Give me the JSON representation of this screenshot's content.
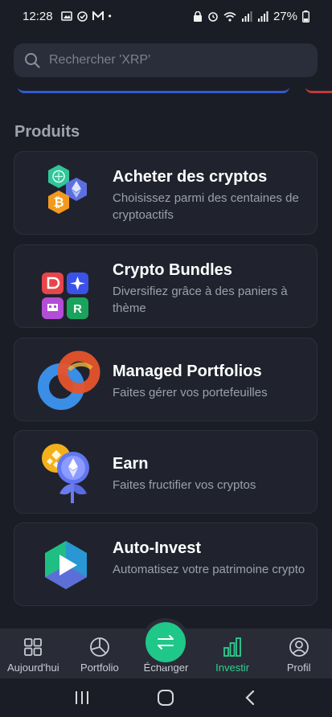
{
  "status_bar": {
    "time": "12:28",
    "battery": "27%",
    "dot": "•"
  },
  "search": {
    "placeholder": "Rechercher 'XRP'"
  },
  "section": {
    "title": "Produits"
  },
  "products": [
    {
      "title": "Acheter des cryptos",
      "desc": "Choisissez parmi des centaines de cryptoactifs",
      "icon": "crypto-hexagons-icon"
    },
    {
      "title": "Crypto Bundles",
      "desc": "Diversifiez grâce à des paniers à thème",
      "icon": "bundle-tiles-icon"
    },
    {
      "title": "Managed Portfolios",
      "desc": "Faites gérer vos portefeuilles",
      "icon": "portfolio-rings-icon"
    },
    {
      "title": "Earn",
      "desc": "Faites fructifier vos cryptos",
      "icon": "earn-flower-icon"
    },
    {
      "title": "Auto-Invest",
      "desc": "Automatisez votre patrimoine crypto",
      "icon": "auto-invest-play-icon"
    }
  ],
  "bottom_nav": [
    {
      "label": "Aujourd'hui",
      "icon": "grid-icon"
    },
    {
      "label": "Portfolio",
      "icon": "pie-chart-icon"
    },
    {
      "label": "Échanger",
      "icon": "swap-arrows-icon"
    },
    {
      "label": "Investir",
      "icon": "bar-chart-icon",
      "active": true
    },
    {
      "label": "Profil",
      "icon": "user-icon"
    }
  ],
  "colors": {
    "background": "#1b1d26",
    "card": "#20232d",
    "accent": "#2ecf8f",
    "nav_bar": "#292c37"
  }
}
